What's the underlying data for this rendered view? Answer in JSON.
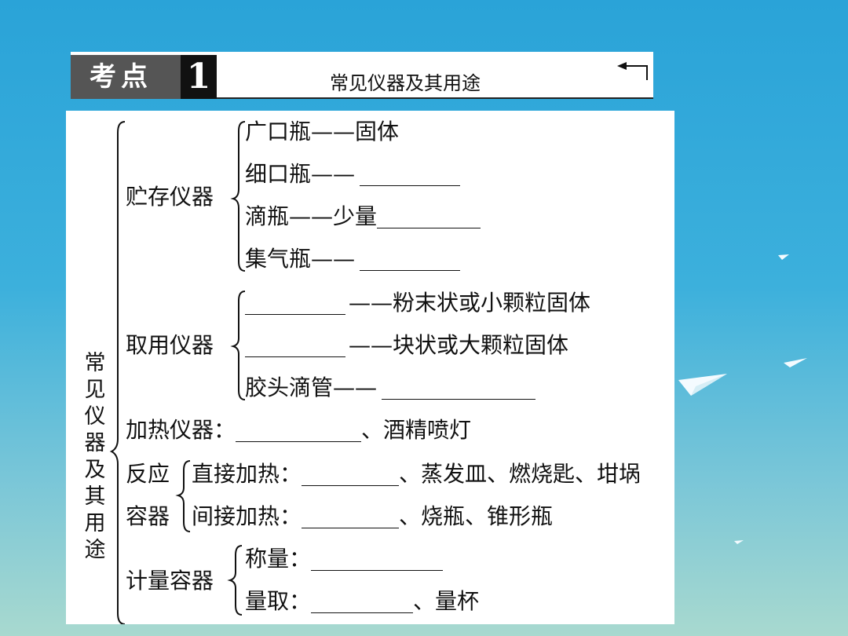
{
  "header": {
    "badge_text": "考点",
    "badge_number": "1",
    "title": "常见仪器及其用途"
  },
  "main_title": "常见仪器及其用途",
  "groups": {
    "storage": {
      "label": "贮存仪器",
      "items": [
        "广口瓶——固体",
        "细口瓶——",
        "滴瓶——少量",
        "集气瓶——"
      ]
    },
    "taking": {
      "label": "取用仪器",
      "items": [
        "——粉末状或小颗粒固体",
        "——块状或大颗粒固体",
        "胶头滴管——"
      ]
    },
    "heating": {
      "label": "加热仪器：",
      "suffix": "、酒精喷灯"
    },
    "reaction": {
      "label_top": "反应",
      "label_bottom": "容器",
      "direct": {
        "label": "直接加热：",
        "suffix": "、蒸发皿、燃烧匙、坩埚"
      },
      "indirect": {
        "label": "间接加热：",
        "suffix": "、烧瓶、锥形瓶"
      }
    },
    "measuring": {
      "label": "计量容器",
      "weigh": "称量：",
      "measure": "量取：",
      "measure_suffix": "、量杯"
    }
  }
}
